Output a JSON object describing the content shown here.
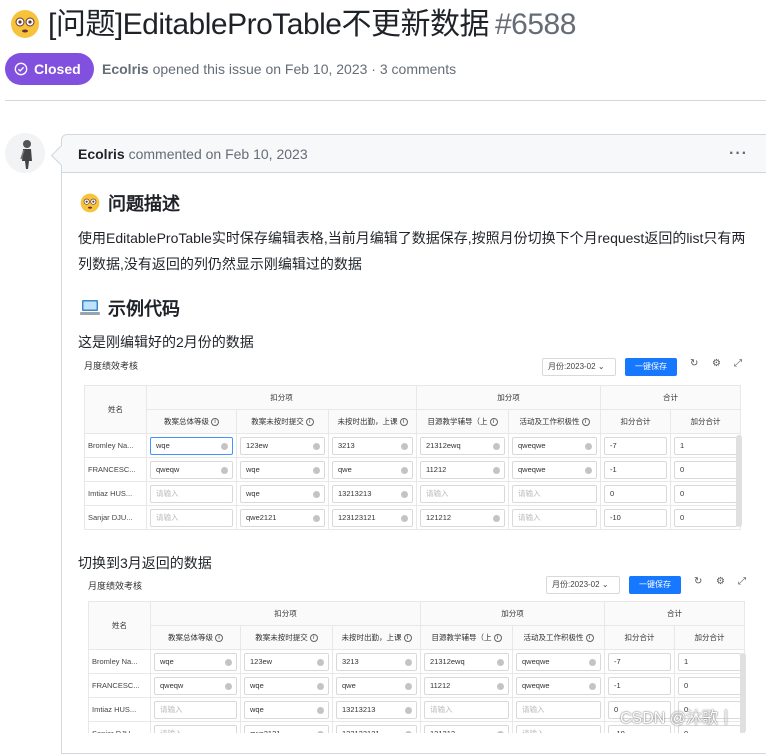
{
  "issue": {
    "title": "[问题]EditableProTable不更新数据",
    "number": "#6588",
    "status": "Closed",
    "author": "Ecolris",
    "opened_text": "opened this issue on Feb 10, 2023 · 3 comments"
  },
  "comment": {
    "author": "Ecolris",
    "date_text": "commented on Feb 10, 2023",
    "more": "···",
    "h1": "问题描述",
    "desc": "使用EditableProTable实时保存编辑表格,当前月编辑了数据保存,按照月份切换下个月request返回的list只有两列数据,没有返回的列仍然显示刚编辑过的数据",
    "h2": "示例代码",
    "cap1": "这是刚编辑好的2月份的数据",
    "cap2": "切换到3月返回的数据"
  },
  "table": {
    "title": "月度绩效考核",
    "month_feb": "月份:2023-02",
    "save": "一键保存",
    "col_name": "姓名",
    "grp_deduct": "扣分项",
    "grp_add": "加分项",
    "grp_total": "合计",
    "sub": [
      "教案总体等级",
      "教案未按时提交",
      "未按时出勤，上课",
      "目源教学辅导（上",
      "活动及工作积极性",
      "扣分合计",
      "加分合计"
    ],
    "rows": [
      {
        "name": "Bromley Na...",
        "c": [
          "wqe",
          "123ew",
          "3213",
          "21312ewq",
          "qweqwe",
          "-7",
          "1"
        ]
      },
      {
        "name": "FRANCESC...",
        "c": [
          "qweqw",
          "wqe",
          "qwe",
          "11212",
          "qweqwe",
          "-1",
          "0"
        ]
      },
      {
        "name": "Imtiaz HUS...",
        "c": [
          "",
          "wqe",
          "13213213",
          "",
          "",
          "0",
          "0"
        ]
      },
      {
        "name": "Sanjar DJU...",
        "c": [
          "",
          "qwe2121",
          "123123121",
          "121212",
          "",
          "-10",
          "0"
        ]
      }
    ],
    "placeholder": "请输入"
  },
  "watermark": "CSDN @沐歌丨"
}
